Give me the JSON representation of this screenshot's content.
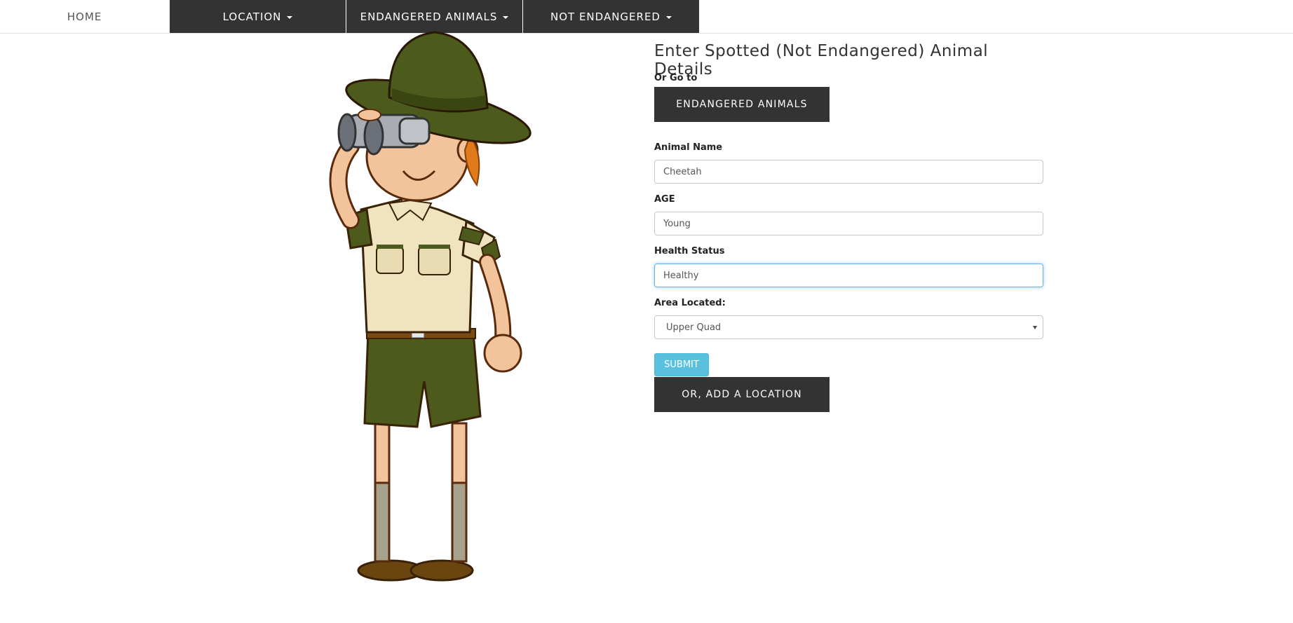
{
  "nav": {
    "home": "HOME",
    "location": "LOCATION",
    "endangered": "ENDANGERED ANIMALS",
    "not_endangered": "NOT ENDANGERED"
  },
  "form": {
    "title": "Enter Spotted (Not Endangered) Animal Details",
    "goto_label": "Or Go to",
    "endangered_button": "ENDANGERED ANIMALS",
    "animal_name_label": "Animal Name",
    "animal_name_value": "Cheetah",
    "age_label": "AGE",
    "age_value": "Young",
    "health_label": "Health Status",
    "health_value": "Healthy",
    "area_label": "Area Located:",
    "area_value": "Upper Quad",
    "submit": "SUBMIT",
    "add_location": "OR, ADD A LOCATION"
  },
  "colors": {
    "nav_dark": "#333333",
    "submit": "#5bc0de",
    "focus_border": "#66afe9"
  },
  "icons": {
    "dropdown": "caret-down-icon",
    "ranger": "park-ranger-with-binoculars-illustration"
  }
}
